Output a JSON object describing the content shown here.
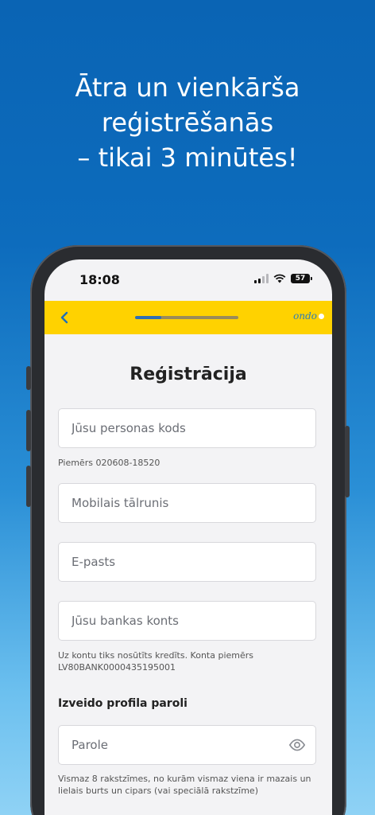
{
  "headline": {
    "line1": "Ātra un vienkārša",
    "line2": "reģistrēšanās",
    "line3": "– tikai 3 minūtēs!"
  },
  "status_bar": {
    "time": "18:08",
    "battery": "57"
  },
  "app_bar": {
    "back_icon": "chevron-left-icon",
    "progress": 0.25,
    "brand": "ondo"
  },
  "form": {
    "title": "Reģistrācija",
    "personal_code": {
      "placeholder": "Jūsu personas kods",
      "hint": "Piemērs 020608-18520"
    },
    "phone": {
      "placeholder": "Mobilais tālrunis"
    },
    "email": {
      "placeholder": "E-pasts"
    },
    "bank_account": {
      "placeholder": "Jūsu bankas konts",
      "hint_line1": "Uz kontu tiks nosūtīts kredīts. Konta piemērs",
      "hint_line2": "LV80BANK0000435195001"
    },
    "password_section": "Izveido profila paroli",
    "password": {
      "placeholder": "Parole",
      "hint_line1": "Vismaz 8 rakstzīmes, no kurām vismaz viena ir mazais un",
      "hint_line2": "lielais burts un cipars (vai speciālā rakstzīme)"
    }
  },
  "colors": {
    "accent": "#ffd200",
    "brand_blue": "#1f6fb8",
    "background": "#0a64b4"
  }
}
